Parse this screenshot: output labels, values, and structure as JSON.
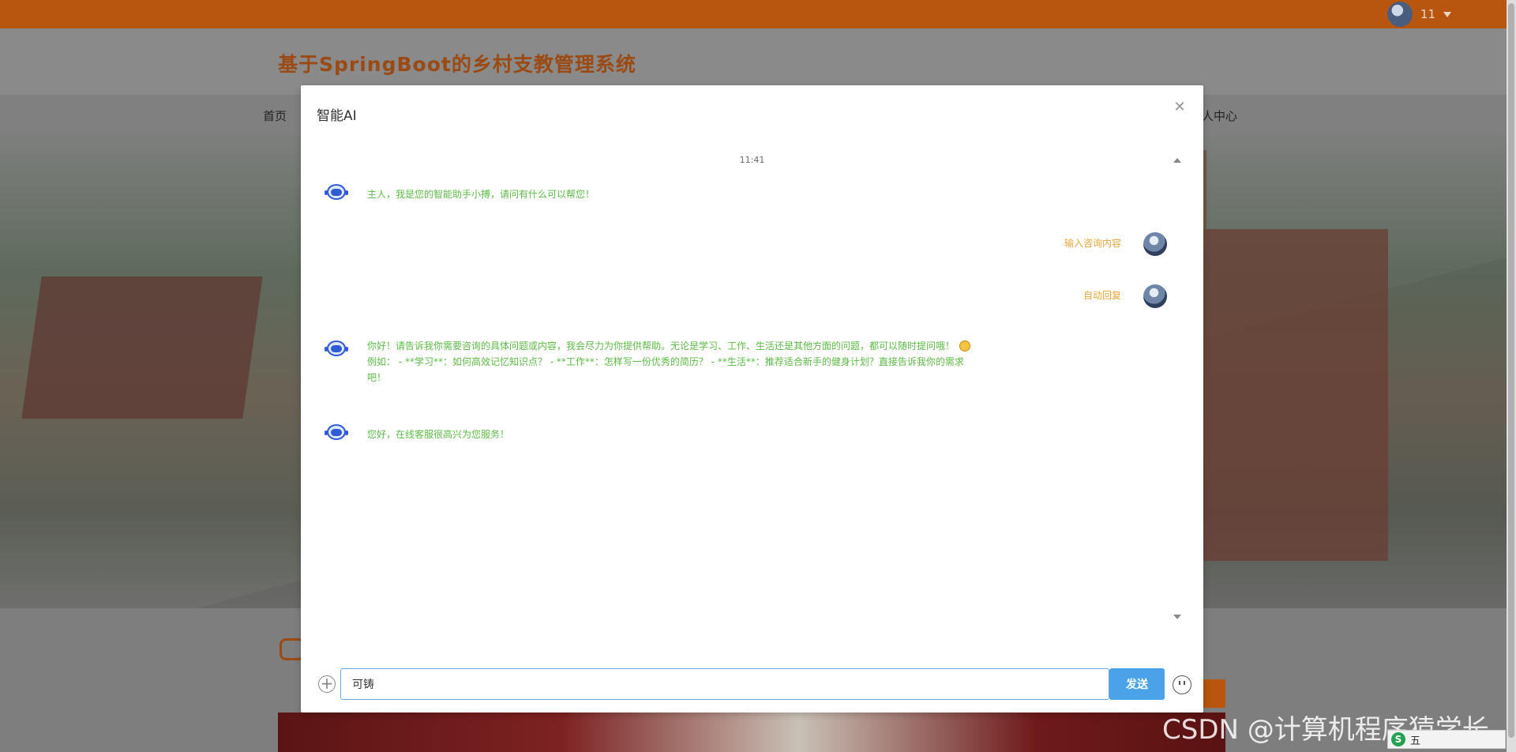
{
  "topbar": {
    "username": "11"
  },
  "header": {
    "site_title": "基于SpringBoot的乡村支教管理系统"
  },
  "nav": {
    "home": "首页",
    "personal_center": "人中心"
  },
  "modal": {
    "title": "智能AI",
    "close_icon": "close-icon",
    "timestamp": "11:41",
    "messages": [
      {
        "side": "left",
        "text": "主人，我是您的智能助手小搏，请问有什么可以帮您！"
      },
      {
        "side": "right",
        "text": "输入咨询内容"
      },
      {
        "side": "right",
        "text": "自动回复"
      },
      {
        "side": "left",
        "text_a": "你好！请告诉我你需要咨询的具体问题或内容，我会尽力为你提供帮助。无论是学习、工作、生活还是其他方面的问题，都可以随时提问哦！",
        "text_b": "例如： - **学习**：如何高效记忆知识点？ - **工作**：怎样写一份优秀的简历？ - **生活**：推荐适合新手的健身计划？直接告诉我你的需求吧！"
      },
      {
        "side": "left",
        "text": "您好，在线客服很高兴为您服务！"
      }
    ],
    "input_value": "可铸",
    "send_label": "发送"
  },
  "watermark": "CSDN @计算机程序猿学长",
  "ime": {
    "label": "五"
  },
  "colors": {
    "accent": "#b8560f",
    "bot_text": "#5dbb46",
    "user_text": "#e8a63a",
    "send": "#4aa3e8"
  }
}
